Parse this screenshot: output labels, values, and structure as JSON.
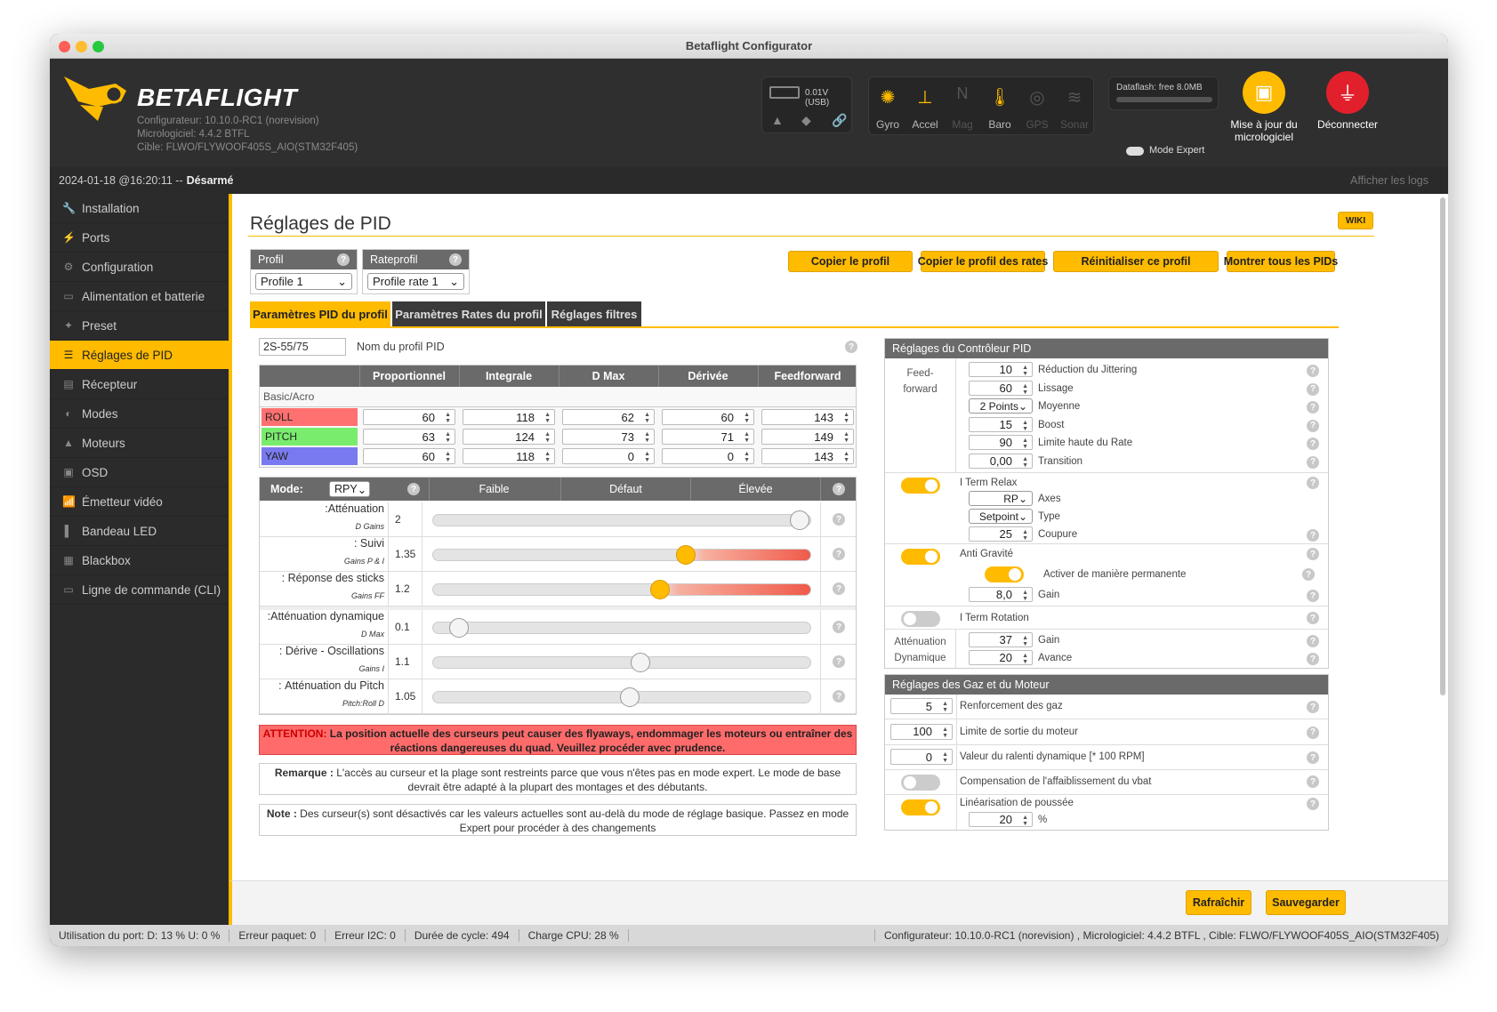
{
  "window": {
    "title": "Betaflight Configurator"
  },
  "header": {
    "brand": "BETAFLIGHT",
    "configurator": "Configurateur: 10.10.0-RC1 (norevision)",
    "firmware": "Micrologiciel: 4.4.2 BTFL",
    "target": "Cible: FLWO/FLYWOOF405S_AIO(STM32F405)",
    "battery": "0.01V (USB)",
    "sensors": [
      "Gyro",
      "Accel",
      "Mag",
      "Baro",
      "GPS",
      "Sonar"
    ],
    "dataflash": "Dataflash: free 8.0MB",
    "expert_mode": "Mode Expert",
    "update_button": "Mise à jour du micrologiciel",
    "disconnect_button": "Déconnecter"
  },
  "statusline": {
    "datetime": "2024-01-18 @16:20:11 -- ",
    "state": "Désarmé",
    "show_logs": "Afficher les logs"
  },
  "sidebar": {
    "items": [
      {
        "label": "Installation",
        "icon": "wrench-icon"
      },
      {
        "label": "Ports",
        "icon": "plug-icon"
      },
      {
        "label": "Configuration",
        "icon": "gear-icon"
      },
      {
        "label": "Alimentation et batterie",
        "icon": "battery-icon"
      },
      {
        "label": "Preset",
        "icon": "wand-icon"
      },
      {
        "label": "Réglages de PID",
        "icon": "sliders-icon"
      },
      {
        "label": "Récepteur",
        "icon": "receiver-icon"
      },
      {
        "label": "Modes",
        "icon": "switch-icon"
      },
      {
        "label": "Moteurs",
        "icon": "motor-icon"
      },
      {
        "label": "OSD",
        "icon": "osd-icon"
      },
      {
        "label": "Émetteur vidéo",
        "icon": "antenna-icon"
      },
      {
        "label": "Bandeau LED",
        "icon": "led-icon"
      },
      {
        "label": "Blackbox",
        "icon": "blackbox-icon"
      },
      {
        "label": "Ligne de commande (CLI)",
        "icon": "terminal-icon"
      }
    ]
  },
  "page": {
    "title": "Réglages de PID",
    "wiki": "WIKI",
    "profile_label": "Profil",
    "profile_value": "Profile 1",
    "rateprofile_label": "Rateprofil",
    "rateprofile_value": "Profile rate 1",
    "buttons": [
      "Copier le profil",
      "Copier le profil des rates",
      "Réinitialiser ce profil",
      "Montrer tous les PIDs"
    ],
    "tabs": [
      "Paramètres PID du profil",
      "Paramètres Rates du profil",
      "Réglages filtres"
    ],
    "profile_name_value": "2S-55/75",
    "profile_name_label": "Nom du profil PID"
  },
  "pid_table": {
    "headers": [
      "Proportionnel",
      "Integrale",
      "D Max",
      "Dérivée",
      "Feedforward"
    ],
    "section": "Basic/Acro",
    "rows": [
      {
        "axis": "ROLL",
        "color": "#ff7070",
        "values": [
          "60",
          "118",
          "62",
          "60",
          "143"
        ]
      },
      {
        "axis": "PITCH",
        "color": "#79ec6e",
        "values": [
          "63",
          "124",
          "73",
          "71",
          "149"
        ]
      },
      {
        "axis": "YAW",
        "color": "#7a7af0",
        "values": [
          "60",
          "118",
          "0",
          "0",
          "143"
        ]
      }
    ]
  },
  "sliders": {
    "mode_label": "Mode:",
    "mode_value": "RPY",
    "cols": [
      "Faible",
      "Défaut",
      "Élevée"
    ],
    "rows": [
      {
        "label": "Atténuation:",
        "sub": "D Gains",
        "value": "2",
        "level": 0.97,
        "active": false
      },
      {
        "label": "Suivi :",
        "sub": "Gains P & I",
        "value": "1.35",
        "level": 0.67,
        "active": true
      },
      {
        "label": "Réponse des sticks :",
        "sub": "Gains FF",
        "value": "1.2",
        "level": 0.6,
        "active": true
      },
      {
        "label": "Atténuation dynamique:",
        "sub": "D Max",
        "value": "0.1",
        "level": 0.07,
        "active": false
      },
      {
        "label": "Dérive - Oscillations :",
        "sub": "Gains I",
        "value": "1.1",
        "level": 0.55,
        "active": false
      },
      {
        "label": "Atténuation du Pitch :",
        "sub": "Pitch:Roll D",
        "value": "1.05",
        "level": 0.52,
        "active": false
      }
    ]
  },
  "notes": {
    "warning_bold": "ATTENTION:",
    "warning_text": "La position actuelle des curseurs peut causer des flyaways, endommager les moteurs ou entraîner des réactions dangereuses du quad. Veuillez procéder avec prudence.",
    "remark_bold": "Remarque :",
    "remark_text": "L'accès au curseur et la plage sont restreints parce que vous n'êtes pas en mode expert. Le mode de base devrait être adapté à la plupart des montages et des débutants.",
    "note_bold": "Note :",
    "note_text": "Des curseur(s) sont désactivés car les valeurs actuelles sont au-delà du mode de réglage basique. Passez en mode Expert pour procéder à des changements"
  },
  "controller": {
    "title": "Réglages du Contrôleur PID",
    "ff_label1": "Feed-",
    "ff_label2": "forward",
    "ff_fields": [
      {
        "value": "10",
        "label": "Réduction du Jittering"
      },
      {
        "value": "60",
        "label": "Lissage"
      },
      {
        "value": "2 Points",
        "label": "Moyenne"
      },
      {
        "value": "15",
        "label": "Boost"
      },
      {
        "value": "90",
        "label": "Limite haute du Rate"
      },
      {
        "value": "0,00",
        "label": "Transition"
      }
    ],
    "iterm_relax": "I Term Relax",
    "iterm_axes_value": "RP",
    "iterm_axes_label": "Axes",
    "iterm_type_value": "Setpoint",
    "iterm_type_label": "Type",
    "iterm_cutoff_value": "25",
    "iterm_cutoff_label": "Coupure",
    "anti_gravity": "Anti Gravité",
    "anti_gravity_perm": "Activer de manière permanente",
    "anti_gravity_gain_value": "8,0",
    "anti_gravity_gain_label": "Gain",
    "iterm_rotation": "I Term Rotation",
    "dyn_att1": "Atténuation",
    "dyn_att2": "Dynamique",
    "dyn_gain_value": "37",
    "dyn_gain_label": "Gain",
    "dyn_adv_value": "20",
    "dyn_adv_label": "Avance"
  },
  "throttle": {
    "title": "Réglages des Gaz et du Moteur",
    "rows": [
      {
        "value": "5",
        "label": "Renforcement des gaz"
      },
      {
        "value": "100",
        "label": "Limite de sortie du moteur"
      },
      {
        "value": "0",
        "label": "Valeur du ralenti dynamique [* 100 RPM]"
      }
    ],
    "vbat": "Compensation de l'affaiblissement du vbat",
    "linearisation": "Linéarisation de poussée",
    "lin_value": "20",
    "lin_unit": "%"
  },
  "footer": {
    "refresh": "Rafraîchir",
    "save": "Sauvegarder"
  },
  "statusbar": {
    "port": "Utilisation du port: D: 13 % U: 0 %",
    "packet": "Erreur paquet: 0",
    "i2c": "Erreur I2C: 0",
    "cycle": "Durée de cycle: 494",
    "cpu": "Charge CPU: 28 %",
    "version": "Configurateur: 10.10.0-RC1 (norevision) , Micrologiciel: 4.4.2 BTFL , Cible: FLWO/FLYWOOF405S_AIO(STM32F405)"
  }
}
